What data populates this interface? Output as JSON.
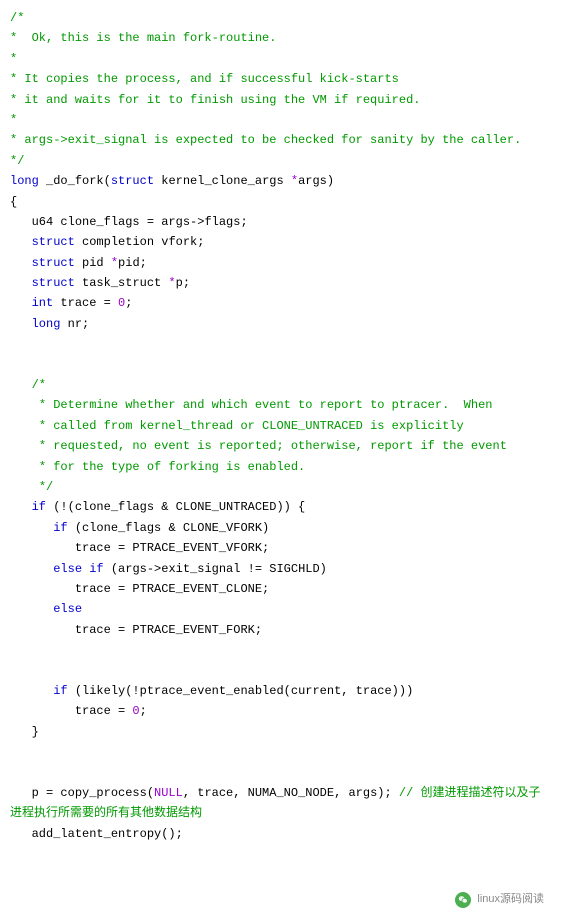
{
  "code": {
    "c1": "/*",
    "c2": "*  Ok, this is the main fork-routine.",
    "c3": "*",
    "c4": "* It copies the process, and if successful kick-starts",
    "c5": "* it and waits for it to finish using the VM if required.",
    "c6": "*",
    "c7": "* args->exit_signal is expected to be checked for sanity by the caller.",
    "c8": "*/",
    "kw_long": "long",
    "fn": " _do_fork(",
    "kw_struct1": "struct",
    "arg_rest": " kernel_clone_args ",
    "star": "*",
    "arg_name": "args)",
    "brace_open": "{",
    "decl_u64": "   u64 clone_flags = args->flags;",
    "decl_struct1a": "   ",
    "kw_struct2": "struct",
    "decl_struct1b": " completion vfork;",
    "decl_struct2a": "   ",
    "kw_struct3": "struct",
    "decl_struct2b": " pid ",
    "decl_struct2c": "pid;",
    "decl_struct3a": "   ",
    "kw_struct4": "struct",
    "decl_struct3b": " task_struct ",
    "decl_struct3c": "p;",
    "decl_int_a": "   ",
    "kw_int": "int",
    "decl_int_b": " trace = ",
    "zero1": "0",
    "decl_int_c": ";",
    "decl_long_a": "   ",
    "kw_long2": "long",
    "decl_long_b": " nr;",
    "cmt2_1": "   /*",
    "cmt2_2": "    * Determine whether and which event to report to ptracer.  When",
    "cmt2_3": "    * called from kernel_thread or CLONE_UNTRACED is explicitly",
    "cmt2_4": "    * requested, no event is reported; otherwise, report if the event",
    "cmt2_5": "    * for the type of forking is enabled.",
    "cmt2_6": "    */",
    "if1_a": "   ",
    "kw_if1": "if",
    "if1_b": " (!(clone_flags & CLONE_UNTRACED)) {",
    "if2_a": "      ",
    "kw_if2": "if",
    "if2_b": " (clone_flags & CLONE_VFORK)",
    "tr1": "         trace = PTRACE_EVENT_VFORK;",
    "elif_a": "      ",
    "kw_else1": "else",
    "sp1": " ",
    "kw_if3": "if",
    "elif_b": " (args->exit_signal != SIGCHLD)",
    "tr2": "         trace = PTRACE_EVENT_CLONE;",
    "else_a": "      ",
    "kw_else2": "else",
    "tr3": "         trace = PTRACE_EVENT_FORK;",
    "if3_a": "      ",
    "kw_if4": "if",
    "if3_b": " (likely(!ptrace_event_enabled(current, trace)))",
    "tr4_a": "         trace = ",
    "zero2": "0",
    "tr4_b": ";",
    "brace_close_inner": "   }",
    "copy_a": "   p = copy_process(",
    "null": "NULL",
    "copy_b": ", trace, NUMA_NO_NODE, args); ",
    "zh_comment": "// 创建进程描述符以及子进程执行所需要的所有其他数据结构",
    "entropy": "   add_latent_entropy();"
  },
  "footer": {
    "label": "linux源码阅读"
  }
}
